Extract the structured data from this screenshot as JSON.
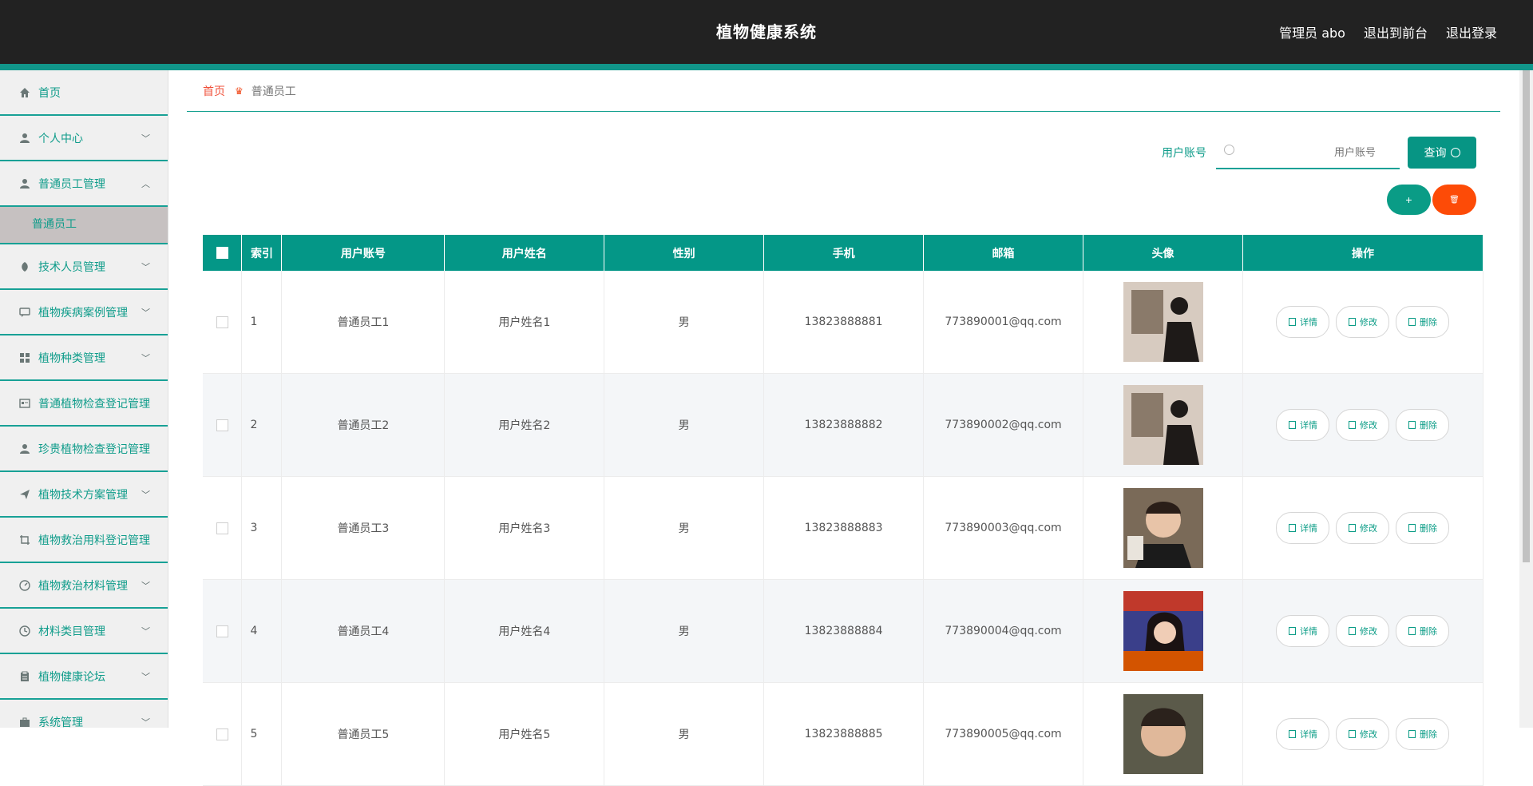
{
  "header": {
    "title": "植物健康系统",
    "admin": "管理员 abo",
    "to_front": "退出到前台",
    "logout": "退出登录"
  },
  "sidebar": {
    "items": [
      {
        "label": "首页",
        "icon": "home-icon",
        "has_chevron": false
      },
      {
        "label": "个人中心",
        "icon": "user-icon",
        "has_chevron": true
      },
      {
        "label": "普通员工管理",
        "icon": "user-icon",
        "has_chevron": true,
        "expanded": true,
        "children": [
          "普通员工"
        ]
      },
      {
        "label": "技术人员管理",
        "icon": "leaf-icon",
        "has_chevron": true
      },
      {
        "label": "植物疾病案例管理",
        "icon": "chat-icon",
        "has_chevron": true
      },
      {
        "label": "植物种类管理",
        "icon": "grid-icon",
        "has_chevron": true
      },
      {
        "label": "普通植物检查登记管理",
        "icon": "card-icon",
        "has_chevron": false
      },
      {
        "label": "珍贵植物检查登记管理",
        "icon": "user-icon",
        "has_chevron": false
      },
      {
        "label": "植物技术方案管理",
        "icon": "send-icon",
        "has_chevron": true
      },
      {
        "label": "植物救治用料登记管理",
        "icon": "crop-icon",
        "has_chevron": false
      },
      {
        "label": "植物救治材料管理",
        "icon": "gauge-icon",
        "has_chevron": true
      },
      {
        "label": "材料类目管理",
        "icon": "clock-icon",
        "has_chevron": true
      },
      {
        "label": "植物健康论坛",
        "icon": "clipboard-icon",
        "has_chevron": true
      },
      {
        "label": "系统管理",
        "icon": "briefcase-icon",
        "has_chevron": true
      }
    ]
  },
  "breadcrumb": {
    "home": "首页",
    "current": "普通员工"
  },
  "search": {
    "label": "用户账号",
    "placeholder": "用户账号",
    "button": "查询"
  },
  "actions": {
    "add": "+",
    "delete": "🗑"
  },
  "table": {
    "columns": [
      "",
      "索引",
      "用户账号",
      "用户姓名",
      "性别",
      "手机",
      "邮箱",
      "头像",
      "操作"
    ],
    "rows": [
      {
        "index": "1",
        "account": "普通员工1",
        "name": "用户姓名1",
        "gender": "男",
        "phone": "13823888881",
        "email": "773890001@qq.com"
      },
      {
        "index": "2",
        "account": "普通员工2",
        "name": "用户姓名2",
        "gender": "男",
        "phone": "13823888882",
        "email": "773890002@qq.com"
      },
      {
        "index": "3",
        "account": "普通员工3",
        "name": "用户姓名3",
        "gender": "男",
        "phone": "13823888883",
        "email": "773890003@qq.com"
      },
      {
        "index": "4",
        "account": "普通员工4",
        "name": "用户姓名4",
        "gender": "男",
        "phone": "13823888884",
        "email": "773890004@qq.com"
      },
      {
        "index": "5",
        "account": "普通员工5",
        "name": "用户姓名5",
        "gender": "男",
        "phone": "13823888885",
        "email": "773890005@qq.com"
      }
    ],
    "row_ops": {
      "detail": "详情",
      "edit": "修改",
      "delete": "删除"
    }
  },
  "colors": {
    "accent": "#079584",
    "danger": "#fd4b07",
    "header": "#222222"
  }
}
